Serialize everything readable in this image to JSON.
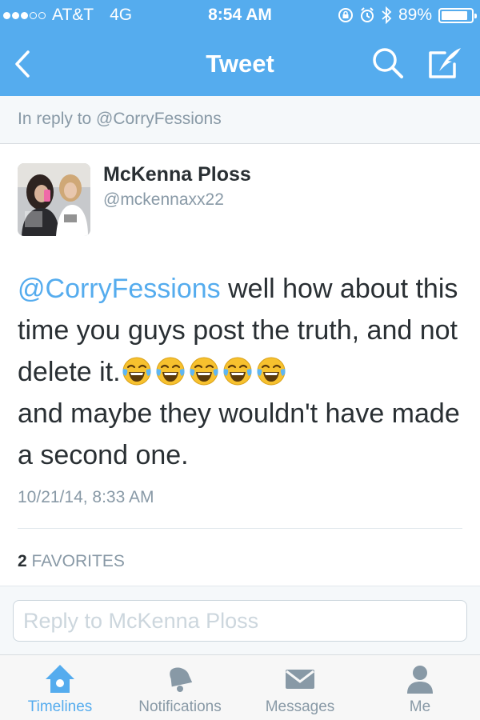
{
  "status_bar": {
    "carrier": "AT&T",
    "network": "4G",
    "time": "8:54 AM",
    "battery_percent": "89%",
    "battery_level": 0.89,
    "signal_bars_filled": 3,
    "signal_bars_total": 5
  },
  "nav": {
    "title": "Tweet",
    "back_icon": "chevron-left-icon",
    "search_icon": "search-icon",
    "compose_icon": "compose-icon"
  },
  "reply_context": "In reply to @CorryFessions",
  "author": {
    "name": "McKenna Ploss",
    "handle": "@mckennaxx22"
  },
  "tweet": {
    "mention": "@CorryFessions",
    "text_1": " well how about this time you guys post the truth, and not delete it.",
    "emoji_count": 5,
    "emoji_name": "face-with-tears-of-joy-icon",
    "text_2": "and maybe they wouldn't have made a second one."
  },
  "timestamp": "10/21/14, 8:33 AM",
  "favorites": {
    "count": "2",
    "label": "FAVORITES"
  },
  "reply_box": {
    "placeholder": "Reply to McKenna Ploss"
  },
  "tabs": [
    {
      "label": "Timelines",
      "icon": "home-icon",
      "active": true
    },
    {
      "label": "Notifications",
      "icon": "bell-icon",
      "active": false
    },
    {
      "label": "Messages",
      "icon": "envelope-icon",
      "active": false
    },
    {
      "label": "Me",
      "icon": "person-icon",
      "active": false
    }
  ],
  "colors": {
    "accent": "#55acee",
    "text": "#292f33",
    "muted": "#8899a6",
    "emoji_yellow": "#f7c12e"
  }
}
